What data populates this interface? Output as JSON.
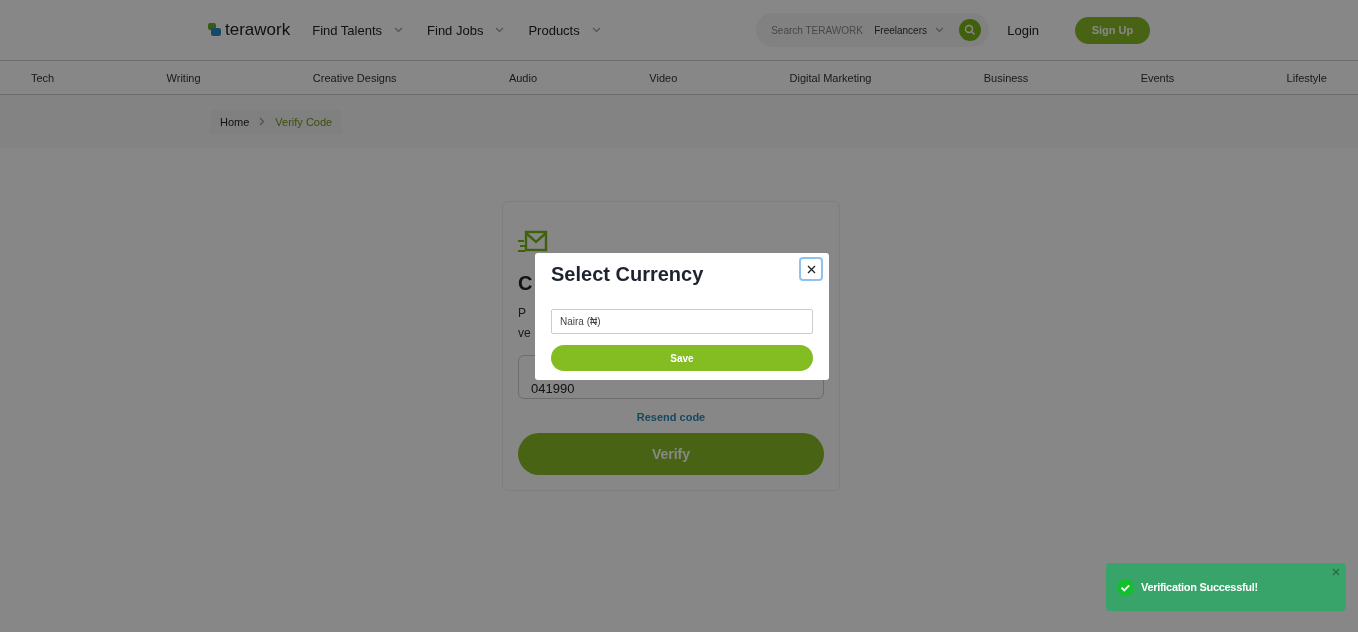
{
  "header": {
    "logo": "terawork",
    "nav": [
      {
        "label": "Find Talents"
      },
      {
        "label": "Find Jobs"
      },
      {
        "label": "Products"
      }
    ],
    "search": {
      "placeholder": "Search TERAWORK",
      "scope": "Freelancers"
    },
    "login": "Login",
    "signup": "Sign Up"
  },
  "categories": [
    "Tech",
    "Writing",
    "Creative Designs",
    "Audio",
    "Video",
    "Digital Marketing",
    "Business",
    "Events",
    "Lifestyle"
  ],
  "breadcrumb": [
    {
      "label": "Home",
      "selected": false
    },
    {
      "label": "Verify Code",
      "selected": true
    }
  ],
  "card": {
    "heading": "C",
    "text_lines": [
      "P",
      "ve"
    ],
    "code_value": "041990",
    "resend": "Resend code",
    "verify": "Verify"
  },
  "modal": {
    "title": "Select Currency",
    "currency": "Naira (₦)",
    "save": "Save"
  },
  "toast": {
    "message": "Verification Successful!"
  }
}
